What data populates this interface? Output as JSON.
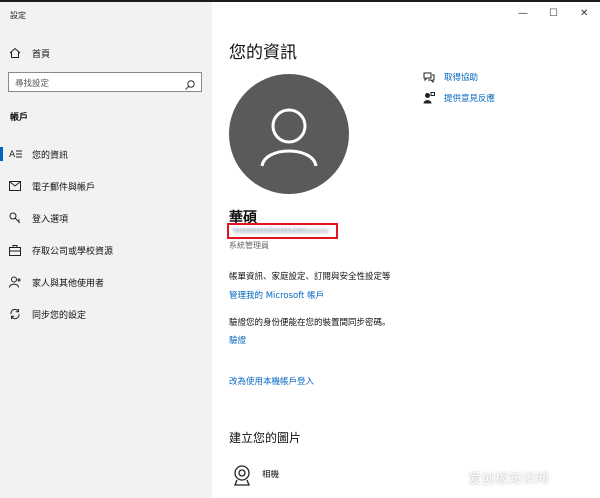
{
  "window": {
    "title": "設定",
    "controls": {
      "minimize": "—",
      "maximize": "☐",
      "close": "✕"
    }
  },
  "sidebar": {
    "home_label": "首頁",
    "search_placeholder": "尋找設定",
    "section_title": "帳戶",
    "items": [
      {
        "label": "您的資訊",
        "icon": "user-card-icon",
        "selected": true
      },
      {
        "label": "電子郵件與帳戶",
        "icon": "mail-icon"
      },
      {
        "label": "登入選項",
        "icon": "key-icon"
      },
      {
        "label": "存取公司或學校資源",
        "icon": "briefcase-icon"
      },
      {
        "label": "家人與其他使用者",
        "icon": "person-add-icon"
      },
      {
        "label": "同步您的設定",
        "icon": "sync-icon"
      }
    ]
  },
  "main": {
    "title": "您的資訊",
    "user_name": "華碩",
    "email_masked": "xxxxxxxxxx@xxxxx.com",
    "role": "系統管理員",
    "billing_text": "帳單資訊、家庭設定、訂閱與安全性設定等",
    "manage_link": "管理我的 Microsoft 帳戶",
    "verify_text": "驗證您的身份便能在您的裝置間同步密碼。",
    "verify_link": "驗證",
    "local_account_link": "改為使用本機帳戶登入",
    "picture_heading": "建立您的圖片",
    "camera_label": "相機"
  },
  "help": {
    "get_help": "取得協助",
    "feedback": "提供意見反應"
  },
  "watermark": "爱创根知识网",
  "colors": {
    "accent": "#0067c0",
    "avatar_bg": "#5a5a5a",
    "highlight": "#e1141f",
    "sidebar_bg": "#f2f2f2"
  }
}
